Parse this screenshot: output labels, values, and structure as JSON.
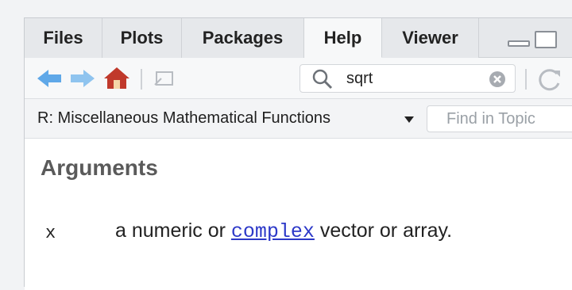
{
  "tabs": [
    {
      "label": "Files",
      "active": false
    },
    {
      "label": "Plots",
      "active": false
    },
    {
      "label": "Packages",
      "active": false
    },
    {
      "label": "Help",
      "active": true
    },
    {
      "label": "Viewer",
      "active": false
    }
  ],
  "toolbar": {
    "icons": [
      "back-arrow-icon",
      "forward-arrow-icon",
      "home-icon",
      "popout-window-icon",
      "refresh-icon"
    ],
    "search": {
      "value": "sqrt",
      "icon": "search-icon",
      "clear_icon": "clear-icon"
    }
  },
  "topic": {
    "title": "R: Miscellaneous Mathematical Functions",
    "find_placeholder": "Find in Topic"
  },
  "content": {
    "heading": "Arguments",
    "argument": {
      "name": "x",
      "desc_before": "a numeric or ",
      "link": "complex",
      "desc_after": " vector or array."
    }
  },
  "colors": {
    "accent_blue": "#5fa8e8",
    "home_red": "#c0392b",
    "link": "#2c38c8"
  }
}
